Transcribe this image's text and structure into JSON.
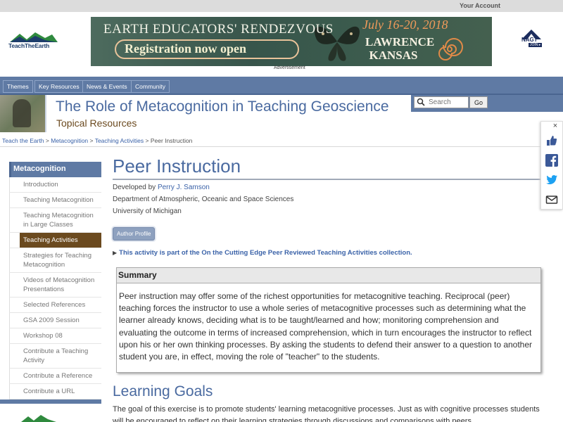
{
  "topbar": {
    "account": "Your Account"
  },
  "header": {
    "logo_text": "TeachTheEarth",
    "ad": {
      "headline": "EARTH EDUCATORS' RENDEZVOUS",
      "cta": "Registration now open",
      "date": "July 16-20, 2018",
      "city_line1": "LAWRENCE",
      "city_line2": "KANSAS"
    },
    "ad_label": "Advertisement",
    "nagt": {
      "word": "NAGT",
      "join": "JOIN ▸"
    }
  },
  "nav": {
    "items": [
      "Themes",
      "Key Resources",
      "News & Events",
      "Community"
    ]
  },
  "title": {
    "site": "The Role of Metacognition in Teaching Geoscience",
    "subtitle": "Topical Resources"
  },
  "search": {
    "placeholder": "Search",
    "button": "Go"
  },
  "breadcrumb": {
    "items": [
      "Teach the Earth",
      "Metacognition",
      "Teaching Activities"
    ],
    "current": "Peer Instruction",
    "sep": " > "
  },
  "sidebar": {
    "heading": "Metacognition",
    "items": [
      "Introduction",
      "Teaching Metacognition",
      "Teaching Metacognition in Large Classes",
      "Teaching Activities",
      "Strategies for Teaching Metacognition",
      "Videos of Metacognition Presentations",
      "Selected References",
      "GSA 2009 Session",
      "Workshop 08",
      "Contribute a Teaching Activity",
      "Contribute a Reference",
      "Contribute a URL"
    ],
    "active_index": 3
  },
  "main": {
    "title": "Peer Instruction",
    "developed_by_prefix": "Developed by ",
    "author": "Perry J. Samson",
    "department": "Department of Atmospheric, Oceanic and Space Sciences",
    "university": "University of Michigan",
    "author_profile": "Author Profile",
    "collection_note": "This activity is part of the On the Cutting Edge Peer Reviewed Teaching Activities collection.",
    "summary_heading": "Summary",
    "summary_text": "Peer instruction may offer some of the richest opportunities for metacognitive teaching. Reciprocal (peer) teaching forces the instructor to use a whole series of metacognitive processes such as determining what the learner already knows, deciding what is to be taught/learned and how; monitoring comprehension and evaluating the outcome in terms of increased comprehension, which in turn encourages the instructor to reflect upon his or her own thinking processes. By asking the students to defend their answer to a question to another student you are, in effect, moving the role of \"teacher\" to the students.",
    "learning_goals_heading": "Learning Goals",
    "learning_goals_text": "The goal of this exercise is to promote students' learning metacognitive processes. Just as with cognitive processes students will be encouraged to reflect on their learning strategies through discussions and comparisons with peers."
  },
  "share": {
    "close": "×",
    "icons": [
      "thumbs-up-icon",
      "facebook-icon",
      "twitter-icon",
      "email-icon"
    ]
  },
  "colors": {
    "nav": "#5f7aa4",
    "title": "#4a6aa0",
    "active": "#6b4a1f",
    "link": "#3a62a8"
  }
}
